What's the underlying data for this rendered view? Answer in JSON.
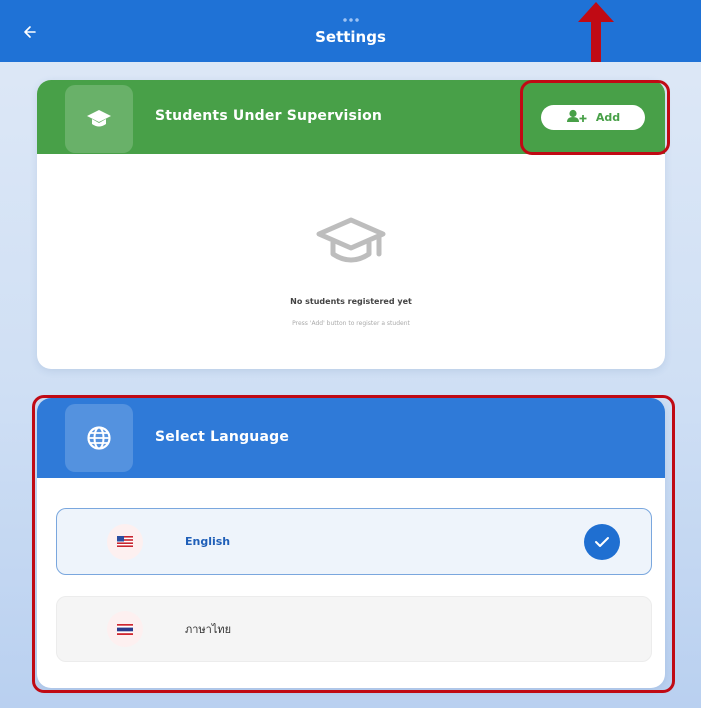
{
  "header": {
    "title": "Settings",
    "back_icon": "arrow-left-icon"
  },
  "students_card": {
    "title": "Students Under Supervision",
    "icon": "graduation-cap-icon",
    "add_button_label": "Add",
    "add_button_icon": "add-user-icon",
    "header_color": "#48a048",
    "empty_title": "No students registered yet",
    "empty_subtitle": "Press 'Add' button to register a student"
  },
  "language_card": {
    "title": "Select Language",
    "icon": "globe-icon",
    "header_color": "#2f7ad8",
    "options": [
      {
        "label": "English",
        "flag": "us-flag-icon",
        "selected": true
      },
      {
        "label": "ภาษาไทย",
        "flag": "thai-flag-icon",
        "selected": false
      }
    ]
  },
  "annotation_color": "#c00a14"
}
